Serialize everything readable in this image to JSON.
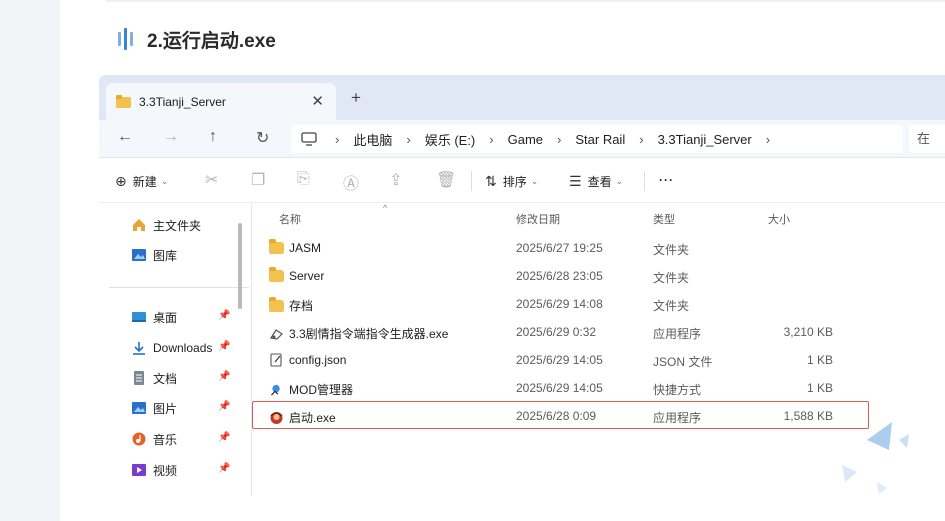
{
  "article": {
    "title": "2.运行启动.exe"
  },
  "tab": {
    "label": "3.3Tianji_Server",
    "close": "✕",
    "add": "+"
  },
  "nav": {
    "back": "←",
    "forward": "→",
    "up": "↑",
    "refresh": "↻",
    "path": [
      "此电脑",
      "娱乐 (E:)",
      "Game",
      "Star Rail",
      "3.3Tianji_Server"
    ],
    "path_separator": "›",
    "search_placeholder": "在"
  },
  "toolbar": {
    "new_label": "新建",
    "sort_label": "排序",
    "view_label": "查看",
    "more": "···"
  },
  "sidebar": {
    "items": [
      {
        "label": "主文件夹",
        "icon": "home-icon",
        "pinned": false
      },
      {
        "label": "图库",
        "icon": "gallery-icon",
        "pinned": false
      },
      {
        "label": "桌面",
        "icon": "desktop-icon",
        "pinned": true
      },
      {
        "label": "Downloads",
        "icon": "download-icon",
        "pinned": true
      },
      {
        "label": "文档",
        "icon": "document-icon",
        "pinned": true
      },
      {
        "label": "图片",
        "icon": "pictures-icon",
        "pinned": true
      },
      {
        "label": "音乐",
        "icon": "music-icon",
        "pinned": true
      },
      {
        "label": "视频",
        "icon": "video-icon",
        "pinned": true
      }
    ]
  },
  "columns": {
    "name": "名称",
    "date": "修改日期",
    "type": "类型",
    "size": "大小"
  },
  "files": [
    {
      "name": "JASM",
      "date": "2025/6/27 19:25",
      "type": "文件夹",
      "size": "",
      "icon": "folder-icon"
    },
    {
      "name": "Server",
      "date": "2025/6/28 23:05",
      "type": "文件夹",
      "size": "",
      "icon": "folder-icon"
    },
    {
      "name": "存档",
      "date": "2025/6/29 14:08",
      "type": "文件夹",
      "size": "",
      "icon": "folder-icon"
    },
    {
      "name": "3.3剧情指令端指令生成器.exe",
      "date": "2025/6/29 0:32",
      "type": "应用程序",
      "size": "3,210 KB",
      "icon": "exe-icon"
    },
    {
      "name": "config.json",
      "date": "2025/6/29 14:05",
      "type": "JSON 文件",
      "size": "1 KB",
      "icon": "json-file-icon"
    },
    {
      "name": "MOD管理器",
      "date": "2025/6/29 14:05",
      "type": "快捷方式",
      "size": "1 KB",
      "icon": "shortcut-icon"
    },
    {
      "name": "启动.exe",
      "date": "2025/6/28 0:09",
      "type": "应用程序",
      "size": "1,588 KB",
      "icon": "launcher-exe-icon"
    }
  ],
  "colors": {
    "accent": "#3b82d6",
    "highlight": "#d65a5a",
    "tabbar": "#dfe8f4",
    "folder": "#f2c14e"
  }
}
